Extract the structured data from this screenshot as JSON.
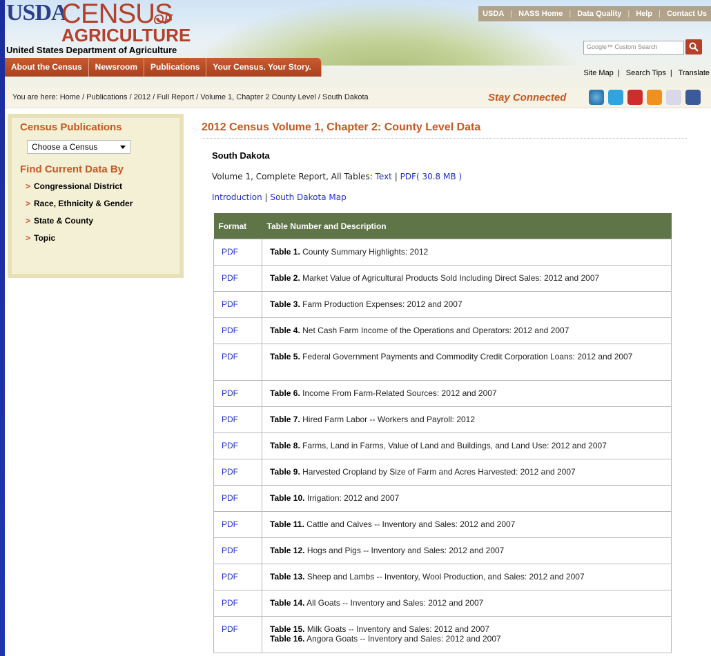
{
  "header": {
    "logo": {
      "usda": "USDA",
      "census": "CENSUS",
      "of": "OF",
      "agriculture": "AGRICULTURE"
    },
    "department": "United States Department of Agriculture",
    "top_links": [
      "USDA",
      "NASS Home",
      "Data Quality",
      "Help",
      "Contact Us"
    ],
    "search_placeholder": "Google™ Custom Search",
    "main_nav": [
      "About the Census",
      "Newsroom",
      "Publications",
      "Your Census. Your Story."
    ],
    "utility_links": [
      "Site Map",
      "Search Tips",
      "Translate"
    ]
  },
  "breadcrumb": "You are here:  Home / Publications / 2012 / Full Report / Volume 1, Chapter 2 County Level / South Dakota",
  "stay_connected": "Stay Connected",
  "social_icons": [
    "census-icon",
    "twitter-icon",
    "youtube-icon",
    "rss-icon",
    "flickr-icon",
    "facebook-icon"
  ],
  "sidebar": {
    "publications_title": "Census Publications",
    "census_select": "Choose a Census",
    "find_title": "Find Current Data By",
    "links": [
      "Congressional District",
      "Race, Ethnicity & Gender",
      "State & County",
      "Topic"
    ]
  },
  "main": {
    "title": "2012 Census Volume 1, Chapter 2: County Level Data",
    "state": "South Dakota",
    "report_prefix": "Volume 1, Complete Report, All Tables: ",
    "report_text_link": "Text",
    "report_pdf_link": "PDF( 30.8 MB )",
    "intro_link": "Introduction",
    "map_link": "South Dakota Map",
    "table_headers": [
      "Format",
      "Table Number and Description"
    ],
    "rows": [
      {
        "format": "PDF",
        "num": "Table 1.",
        "desc": "County Summary Highlights: 2012"
      },
      {
        "format": "PDF",
        "num": "Table 2.",
        "desc": "Market Value of Agricultural Products Sold Including Direct Sales: 2012 and 2007"
      },
      {
        "format": "PDF",
        "num": "Table 3.",
        "desc": "Farm Production Expenses: 2012 and 2007"
      },
      {
        "format": "PDF",
        "num": "Table 4.",
        "desc": "Net Cash Farm Income of the Operations and Operators: 2012 and 2007"
      },
      {
        "format": "PDF",
        "num": "Table 5.",
        "desc": "Federal Government Payments and Commodity Credit Corporation Loans: 2012 and 2007"
      },
      {
        "format": "PDF",
        "num": "Table 6.",
        "desc": "Income From Farm-Related Sources: 2012 and 2007"
      },
      {
        "format": "PDF",
        "num": "Table 7.",
        "desc": "Hired Farm Labor -- Workers and Payroll: 2012"
      },
      {
        "format": "PDF",
        "num": "Table 8.",
        "desc": "Farms, Land in Farms, Value of Land and Buildings, and Land Use: 2012 and 2007"
      },
      {
        "format": "PDF",
        "num": "Table 9.",
        "desc": "Harvested Cropland by Size of Farm and Acres Harvested: 2012 and 2007"
      },
      {
        "format": "PDF",
        "num": "Table 10.",
        "desc": "Irrigation: 2012 and 2007"
      },
      {
        "format": "PDF",
        "num": "Table 11.",
        "desc": "Cattle and Calves -- Inventory and Sales: 2012 and 2007"
      },
      {
        "format": "PDF",
        "num": "Table 12.",
        "desc": "Hogs and Pigs -- Inventory and Sales: 2012 and 2007"
      },
      {
        "format": "PDF",
        "num": "Table 13.",
        "desc": "Sheep and Lambs -- Inventory, Wool Production, and Sales: 2012 and 2007"
      },
      {
        "format": "PDF",
        "num": "Table 14.",
        "desc": "All Goats -- Inventory and Sales: 2012 and 2007"
      },
      {
        "format": "PDF",
        "num": "Table 15.",
        "desc": "Milk Goats -- Inventory and Sales: 2012 and 2007",
        "num2": "Table 16.",
        "desc2": "Angora Goats -- Inventory and Sales: 2012 and 2007"
      }
    ]
  }
}
